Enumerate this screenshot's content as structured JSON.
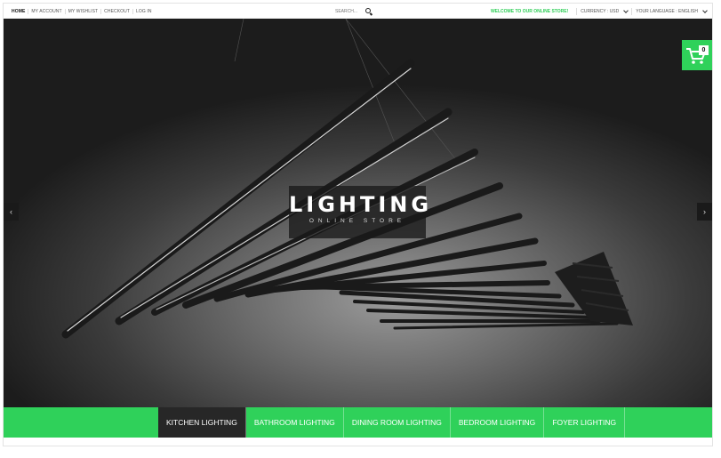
{
  "topbar": {
    "nav": [
      "HOME",
      "MY ACCOUNT",
      "MY WISHLIST",
      "CHECKOUT",
      "LOG IN"
    ],
    "search_placeholder": "SEARCH...",
    "welcome": "WELCOME TO OUR ONLINE STORE!",
    "currency": "CURRENCY : USD",
    "language": "YOUR LANGUAGE : ENGLISH"
  },
  "hero": {
    "title": "LIGHTING",
    "subtitle": "ONLINE STORE",
    "prev": "‹",
    "next": "›"
  },
  "cart": {
    "count": "0"
  },
  "categories": [
    "KITCHEN LIGHTING",
    "BATHROOM LIGHTING",
    "DINING ROOM LIGHTING",
    "BEDROOM LIGHTING",
    "FOYER LIGHTING"
  ],
  "colors": {
    "accent": "#2fd15a",
    "active_category": "#272727"
  }
}
